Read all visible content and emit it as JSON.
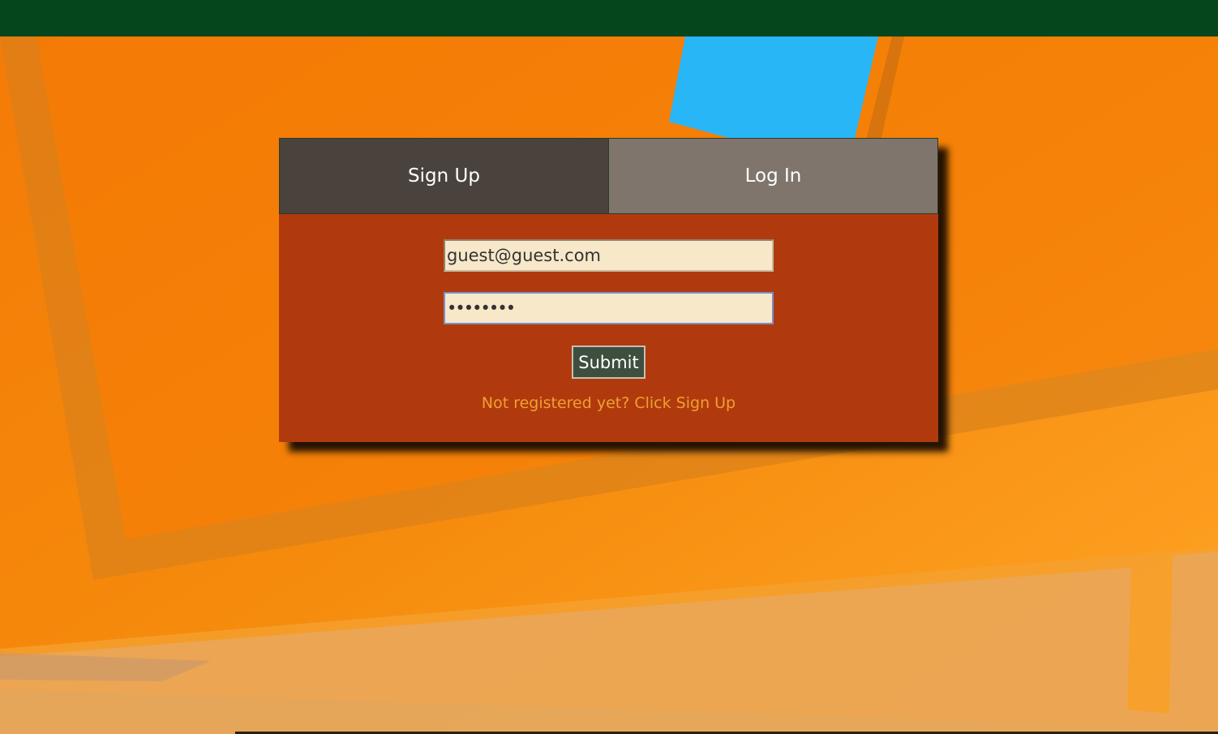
{
  "tabs": {
    "signup_label": "Sign Up",
    "login_label": "Log In"
  },
  "form": {
    "email_value": "guest@guest.com",
    "password_value": "••••••••",
    "submit_label": "Submit",
    "signup_link": "Not registered yet? Click Sign Up"
  },
  "colors": {
    "topbar": "#05461d",
    "card": "#b03a0e",
    "tab_signup": "#4a423c",
    "tab_login": "#7d7870",
    "input_bg": "#f7e8c9",
    "submit_bg": "#3f4f3f",
    "link": "#f0a030",
    "accent_blue": "#29b6f6"
  }
}
